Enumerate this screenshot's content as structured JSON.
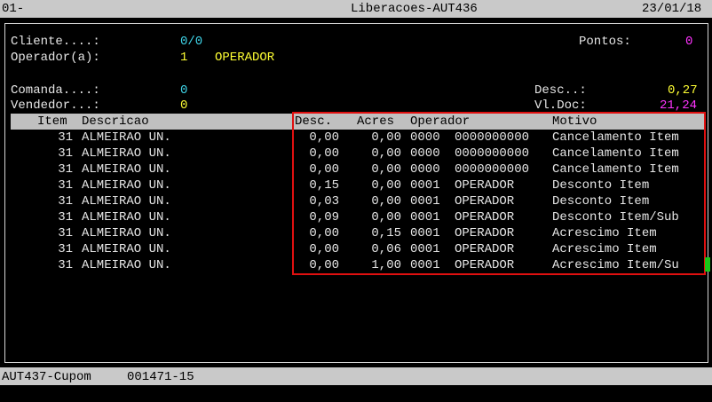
{
  "titlebar": {
    "left": "01-",
    "title": "Liberacoes-AUT436",
    "date": "23/01/18"
  },
  "header": {
    "cliente_label": "Cliente....:",
    "cliente_value": "0/0",
    "pontos_label": "Pontos:",
    "pontos_value": "0",
    "operador_label": "Operador(a):",
    "operador_code": "1",
    "operador_name": "OPERADOR",
    "comanda_label": "Comanda....:",
    "comanda_value": "0",
    "desc_label": "Desc..:",
    "desc_value": "0,27",
    "vendedor_label": "Vendedor...:",
    "vendedor_value": "0",
    "vldoc_label": "Vl.Doc:",
    "vldoc_value": "21,24"
  },
  "table": {
    "columns": {
      "item": "Item",
      "descricao": "Descricao",
      "desc": "Desc.",
      "acres": "Acres",
      "operador": "Operador",
      "motivo": "Motivo"
    },
    "rows": [
      {
        "item": "31",
        "descricao": "ALMEIRAO UN.",
        "desc": "0,00",
        "acres": "0,00",
        "op_code": "0000",
        "op_name": "0000000000",
        "motivo": "Cancelamento Item"
      },
      {
        "item": "31",
        "descricao": "ALMEIRAO UN.",
        "desc": "0,00",
        "acres": "0,00",
        "op_code": "0000",
        "op_name": "0000000000",
        "motivo": "Cancelamento Item"
      },
      {
        "item": "31",
        "descricao": "ALMEIRAO UN.",
        "desc": "0,00",
        "acres": "0,00",
        "op_code": "0000",
        "op_name": "0000000000",
        "motivo": "Cancelamento Item"
      },
      {
        "item": "31",
        "descricao": "ALMEIRAO UN.",
        "desc": "0,15",
        "acres": "0,00",
        "op_code": "0001",
        "op_name": "OPERADOR",
        "motivo": "Desconto Item"
      },
      {
        "item": "31",
        "descricao": "ALMEIRAO UN.",
        "desc": "0,03",
        "acres": "0,00",
        "op_code": "0001",
        "op_name": "OPERADOR",
        "motivo": "Desconto Item"
      },
      {
        "item": "31",
        "descricao": "ALMEIRAO UN.",
        "desc": "0,09",
        "acres": "0,00",
        "op_code": "0001",
        "op_name": "OPERADOR",
        "motivo": "Desconto Item/Sub"
      },
      {
        "item": "31",
        "descricao": "ALMEIRAO UN.",
        "desc": "0,00",
        "acres": "0,15",
        "op_code": "0001",
        "op_name": "OPERADOR",
        "motivo": "Acrescimo Item"
      },
      {
        "item": "31",
        "descricao": "ALMEIRAO UN.",
        "desc": "0,00",
        "acres": "0,06",
        "op_code": "0001",
        "op_name": "OPERADOR",
        "motivo": "Acrescimo Item"
      },
      {
        "item": "31",
        "descricao": "ALMEIRAO UN.",
        "desc": "0,00",
        "acres": "1,00",
        "op_code": "0001",
        "op_name": "OPERADOR",
        "motivo": "Acrescimo Item/Su"
      }
    ]
  },
  "statusbar": {
    "program": "AUT437-Cupom",
    "code": "001471-15"
  },
  "colors": {
    "highlight_box": "#e01010",
    "cursor": "#18c818"
  }
}
